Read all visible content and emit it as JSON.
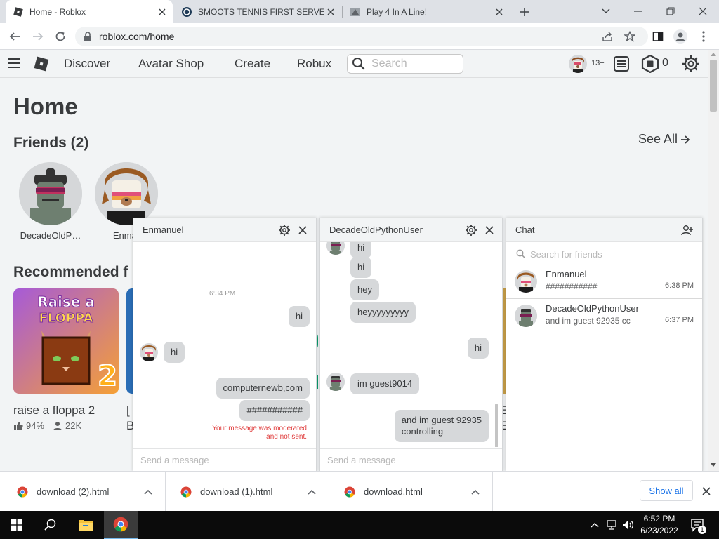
{
  "browser": {
    "tabs": [
      {
        "title": "Home - Roblox",
        "active": true
      },
      {
        "title": "SMOOTS TENNIS FIRST SERVE - …",
        "active": false
      },
      {
        "title": "Play 4 In A Line!",
        "active": false
      }
    ],
    "url": "roblox.com/home"
  },
  "nav": {
    "links": [
      "Discover",
      "Avatar Shop",
      "Create",
      "Robux"
    ],
    "search_placeholder": "Search",
    "age_badge": "13+",
    "robux_count": "0"
  },
  "home": {
    "title": "Home",
    "friends_heading": "Friends (2)",
    "see_all": "See All",
    "friends": [
      {
        "name": "DecadeOldP…"
      },
      {
        "name": "Enmar"
      }
    ],
    "recommended_heading": "Recommended f",
    "game": {
      "name": "raise a floppa 2",
      "rating": "94%",
      "players": "22K",
      "thumb_text_1": "Raise a",
      "thumb_text_2": "FLOPPA",
      "thumb_number": "2"
    },
    "partial_texts": [
      "[",
      "B",
      "E",
      "E"
    ]
  },
  "chat_enmanuel": {
    "title": "Enmanuel",
    "timestamp": "6:34 PM",
    "messages": [
      {
        "text": "hi",
        "side": "right"
      },
      {
        "text": "hi",
        "side": "left"
      },
      {
        "text": "computernewb,com",
        "side": "right"
      },
      {
        "text": "###########",
        "side": "right"
      }
    ],
    "moderation_note_1": "Your message was moderated",
    "moderation_note_2": "and not sent.",
    "input_placeholder": "Send a message"
  },
  "chat_decade": {
    "title": "DecadeOldPythonUser",
    "messages": [
      {
        "text": "hi",
        "side": "left"
      },
      {
        "text": "hi",
        "side": "left"
      },
      {
        "text": "hey",
        "side": "left"
      },
      {
        "text": "heyyyyyyyyy",
        "side": "left"
      },
      {
        "text": "hi",
        "side": "right"
      },
      {
        "text": "im guest9014",
        "side": "left"
      },
      {
        "text": "and im guest 92935",
        "side": "right"
      },
      {
        "text": "controlling",
        "side": "right"
      }
    ],
    "input_placeholder": "Send a message"
  },
  "chat_panel": {
    "title": "Chat",
    "search_placeholder": "Search for friends",
    "conversations": [
      {
        "name": "Enmanuel",
        "preview": "###########",
        "time": "6:38 PM"
      },
      {
        "name": "DecadeOldPythonUser",
        "preview": "and im guest 92935 cc",
        "time": "6:37 PM"
      }
    ]
  },
  "downloads": {
    "items": [
      "download (2).html",
      "download (1).html",
      "download.html"
    ],
    "show_all": "Show all"
  },
  "taskbar": {
    "time": "6:52 PM",
    "date": "6/23/2022",
    "notification_count": "1"
  },
  "colors": {
    "roblox_bg": "#f2f4f5",
    "bubble": "#d6d8da",
    "moderation": "#e03e3e",
    "link_blue": "#1a73e8"
  }
}
